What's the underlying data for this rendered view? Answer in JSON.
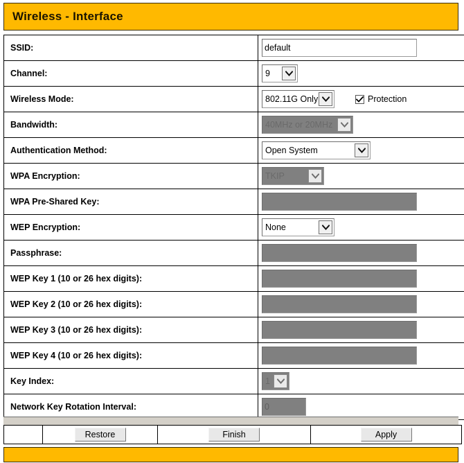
{
  "header": {
    "title": "Wireless - Interface",
    "bg_color": "#ffb900"
  },
  "form": {
    "rows": [
      {
        "label": "SSID:",
        "control": "text",
        "value": "default",
        "disabled": false
      },
      {
        "label": "Channel:",
        "control": "select",
        "value": "9",
        "disabled": false
      },
      {
        "label": "Wireless Mode:",
        "control": "select",
        "value": "802.11G Only",
        "disabled": false,
        "checkbox": {
          "label": "Protection",
          "checked": true
        }
      },
      {
        "label": "Bandwidth:",
        "control": "select",
        "value": "40MHz or 20MHz",
        "disabled": true
      },
      {
        "label": "Authentication Method:",
        "control": "select",
        "value": "Open System",
        "disabled": false
      },
      {
        "label": "WPA Encryption:",
        "control": "select",
        "value": "TKIP",
        "disabled": true
      },
      {
        "label": "WPA Pre-Shared Key:",
        "control": "text",
        "value": "",
        "disabled": true
      },
      {
        "label": "WEP Encryption:",
        "control": "select",
        "value": "None",
        "disabled": false
      },
      {
        "label": "Passphrase:",
        "control": "text",
        "value": "",
        "disabled": true
      },
      {
        "label": "WEP Key 1 (10 or 26 hex digits):",
        "control": "text",
        "value": "",
        "disabled": true
      },
      {
        "label": "WEP Key 2 (10 or 26 hex digits):",
        "control": "text",
        "value": "",
        "disabled": true
      },
      {
        "label": "WEP Key 3 (10 or 26 hex digits):",
        "control": "text",
        "value": "",
        "disabled": true
      },
      {
        "label": "WEP Key 4 (10 or 26 hex digits):",
        "control": "text",
        "value": "",
        "disabled": true
      },
      {
        "label": "Key Index:",
        "control": "select",
        "value": "1",
        "disabled": true
      },
      {
        "label": "Network Key Rotation Interval:",
        "control": "text",
        "value": "0",
        "disabled": true
      }
    ]
  },
  "buttons": {
    "restore": "Restore",
    "finish": "Finish",
    "apply": "Apply"
  },
  "icons": {
    "dropdown": "chevron-down-icon",
    "checkbox_check": "check-icon"
  }
}
